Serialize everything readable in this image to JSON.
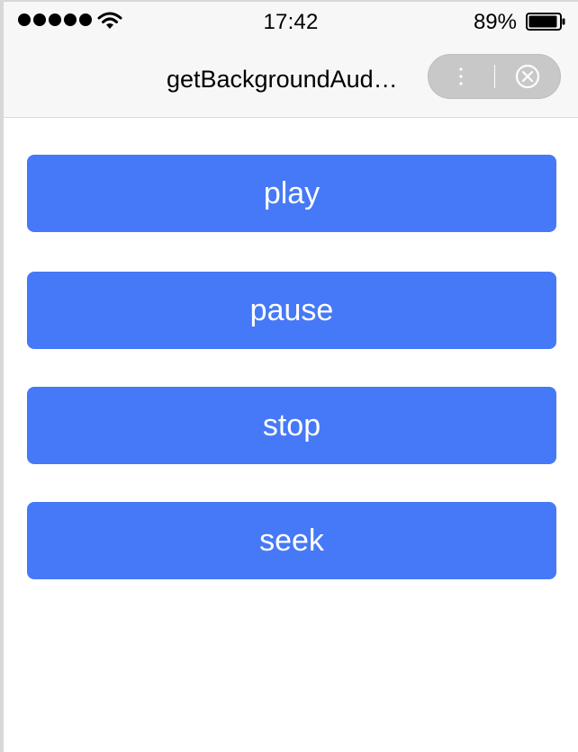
{
  "status_bar": {
    "time": "17:42",
    "battery_percent": "89%",
    "signal_bars": 5,
    "icons": [
      "signal-dots-icon",
      "wifi-icon",
      "battery-icon"
    ]
  },
  "nav": {
    "title": "getBackgroundAud…",
    "menu_icon": "more-vertical-icon",
    "close_icon": "close-circle-icon"
  },
  "buttons": [
    {
      "label": "play"
    },
    {
      "label": "pause"
    },
    {
      "label": "stop"
    },
    {
      "label": "seek"
    }
  ],
  "colors": {
    "accent": "#4679f7",
    "nav_background": "#f7f7f7",
    "capsule": "#c8c8c8"
  }
}
